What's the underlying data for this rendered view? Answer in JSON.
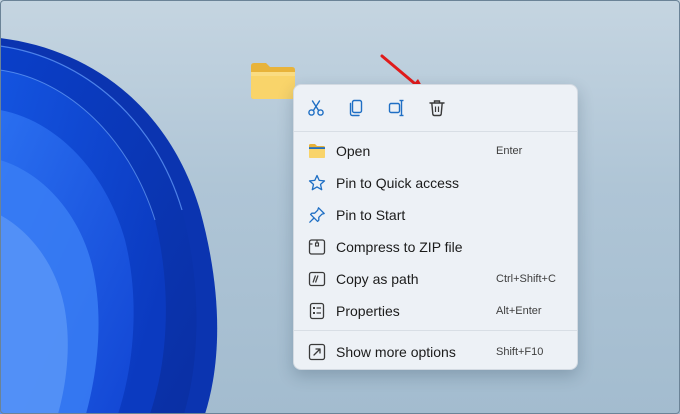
{
  "desktop": {
    "folder": {
      "icon": "folder-icon"
    },
    "annotation": {
      "icon": "red-arrow-icon",
      "color": "#e01b1b"
    }
  },
  "context_menu": {
    "toolbar": [
      {
        "name": "cut-button",
        "icon": "scissors-icon"
      },
      {
        "name": "copy-button",
        "icon": "copy-icon"
      },
      {
        "name": "rename-button",
        "icon": "rename-icon"
      },
      {
        "name": "delete-button",
        "icon": "trash-icon"
      }
    ],
    "items": [
      {
        "label": "Open",
        "shortcut": "Enter",
        "icon": "folder-open-icon"
      },
      {
        "label": "Pin to Quick access",
        "shortcut": "",
        "icon": "star-icon"
      },
      {
        "label": "Pin to Start",
        "shortcut": "",
        "icon": "pin-icon"
      },
      {
        "label": "Compress to ZIP file",
        "shortcut": "",
        "icon": "zip-icon"
      },
      {
        "label": "Copy as path",
        "shortcut": "Ctrl+Shift+C",
        "icon": "path-icon"
      },
      {
        "label": "Properties",
        "shortcut": "Alt+Enter",
        "icon": "properties-icon"
      },
      {
        "label": "Show more options",
        "shortcut": "Shift+F10",
        "icon": "more-options-icon"
      }
    ]
  },
  "colors": {
    "accent": "#1f6fc4",
    "menu_background": "#edf1f6",
    "folder_yellow": "#f7c84a"
  }
}
